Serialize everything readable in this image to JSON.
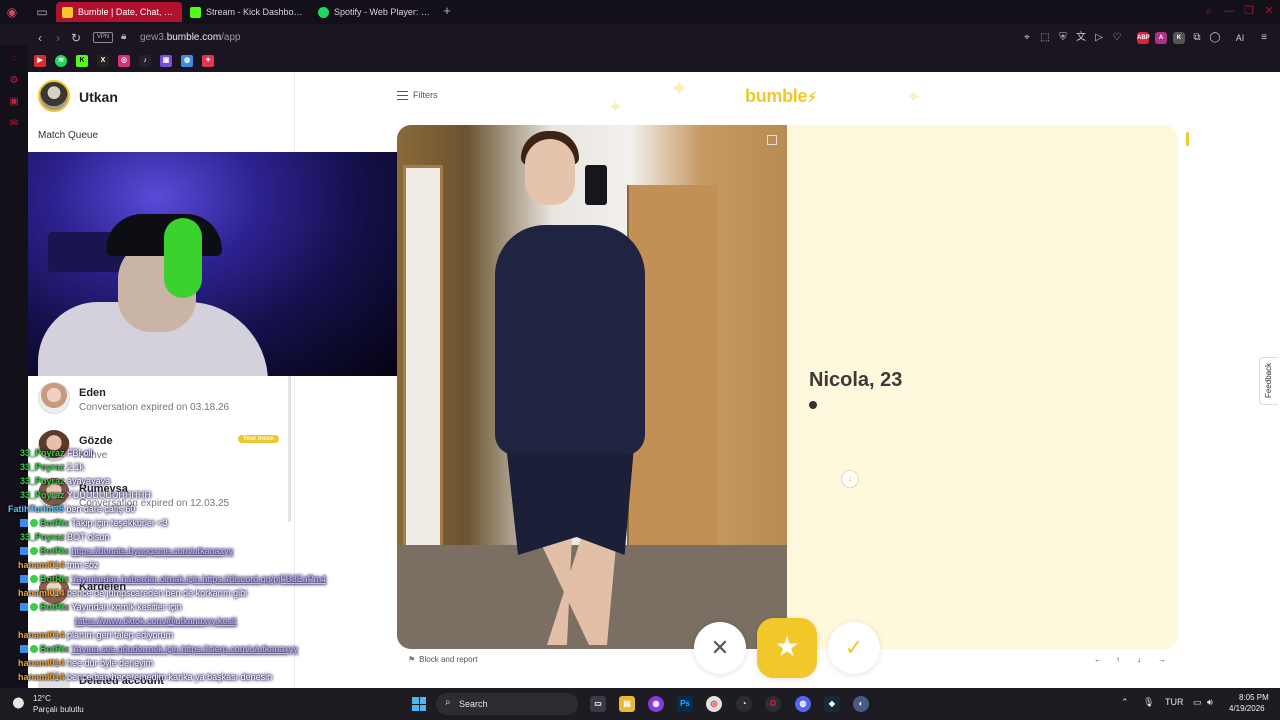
{
  "browser": {
    "tabs": [
      {
        "title": "Bumble | Date, Chat, Meet",
        "favicon_color": "#f1c72a",
        "active": true
      },
      {
        "title": "Stream - Kick Dashboard",
        "favicon_color": "#53fc18",
        "active": false
      },
      {
        "title": "Spotify - Web Player: Heris",
        "favicon_color": "#1ed760",
        "active": false
      }
    ],
    "address": {
      "vpn_label": "VPN",
      "url_prefix": "gew3.",
      "url_domain": "bumble.com",
      "url_path": "/app"
    },
    "toolbar_ai_label": "AI",
    "extensions": [
      "ABP",
      "A",
      "K"
    ]
  },
  "bumble": {
    "user_name": "Utkan",
    "match_queue_label": "Match Queue",
    "filters_label": "Filters",
    "logo_text": "bumble",
    "conversations": [
      {
        "name": "Eden",
        "subtitle": "Conversation expired on 03.18.26"
      },
      {
        "name": "Gözde",
        "subtitle": "Kahve",
        "badge": "Your move"
      },
      {
        "name": "Rumeysa",
        "subtitle": "Conversation expired on 12.03.25"
      },
      {
        "name": "Kardelen",
        "subtitle": ""
      },
      {
        "name": "Deleted account",
        "subtitle": ""
      }
    ],
    "profile": {
      "name_age": "Nicola, 23"
    },
    "block_report_label": "Block and report",
    "feedback_label": "Feedback",
    "keyboard_hints": [
      "←",
      "↑",
      "↓",
      "→"
    ],
    "colors": {
      "brand_yellow": "#f1c72a",
      "card_bg": "#fef8dc"
    }
  },
  "chat": [
    {
      "user": "33_Poyraz",
      "color": "#35d04a",
      "message": "FBI oll"
    },
    {
      "user": "33_Poyraz",
      "color": "#35d04a",
      "message": "2.1k"
    },
    {
      "user": "33_Poyraz",
      "color": "#35d04a",
      "message": "ayayayaya"
    },
    {
      "user": "33_Poyraz",
      "color": "#35d04a",
      "message": "YUUUUUUUHHHHH"
    },
    {
      "user": "FatihTurim35",
      "color": "#5bc2ff",
      "message": "ben dare çalış 60"
    },
    {
      "user": "BotRix",
      "color": "#35d04a",
      "message": "Takip için teşekkürler <3"
    },
    {
      "user": "33_Poyraz",
      "color": "#35d04a",
      "message": "BOT olsun"
    },
    {
      "user": "BotRix",
      "color": "#35d04a",
      "message": "https://donate.bynogame.com/utkanaxyy"
    },
    {
      "user": "hanami014",
      "color": "#f2a33a",
      "message": "tnm söz"
    },
    {
      "user": "BotRix",
      "color": "#35d04a",
      "message": "Yayınlardan haberdar olmak için https://discord.gg/pjFB3EaPm4"
    },
    {
      "user": "hanami014",
      "color": "#f2a33a",
      "message": "bence de jumpscareden ben de korkarım gibi"
    },
    {
      "user": "BotRix",
      "color": "#35d04a",
      "message": "Yayından komik kesitler için"
    },
    {
      "user": "",
      "color": "#35d04a",
      "message": "https://www.tiktok.com/@utkanaxyy.kesit"
    },
    {
      "user": "hanami014",
      "color": "#f2a33a",
      "message": "planım geri talep ediyorum"
    },
    {
      "user": "BotRix",
      "color": "#35d04a",
      "message": "Yayına ses göndermek için https://sierp.com/u/utkanaxyy"
    },
    {
      "user": "hanami014",
      "color": "#f2a33a",
      "message": "hee dur öyle deneyim"
    },
    {
      "user": "hanami014",
      "color": "#f2a33a",
      "message": "bence ban beceremedim kanka ya başkası denesin"
    }
  ],
  "taskbar": {
    "weather_temp": "12°C",
    "weather_desc": "Parçalı bulutlu",
    "search_label": "Search",
    "language": "TUR",
    "time": "8:05 PM",
    "date": "4/19/2026"
  }
}
